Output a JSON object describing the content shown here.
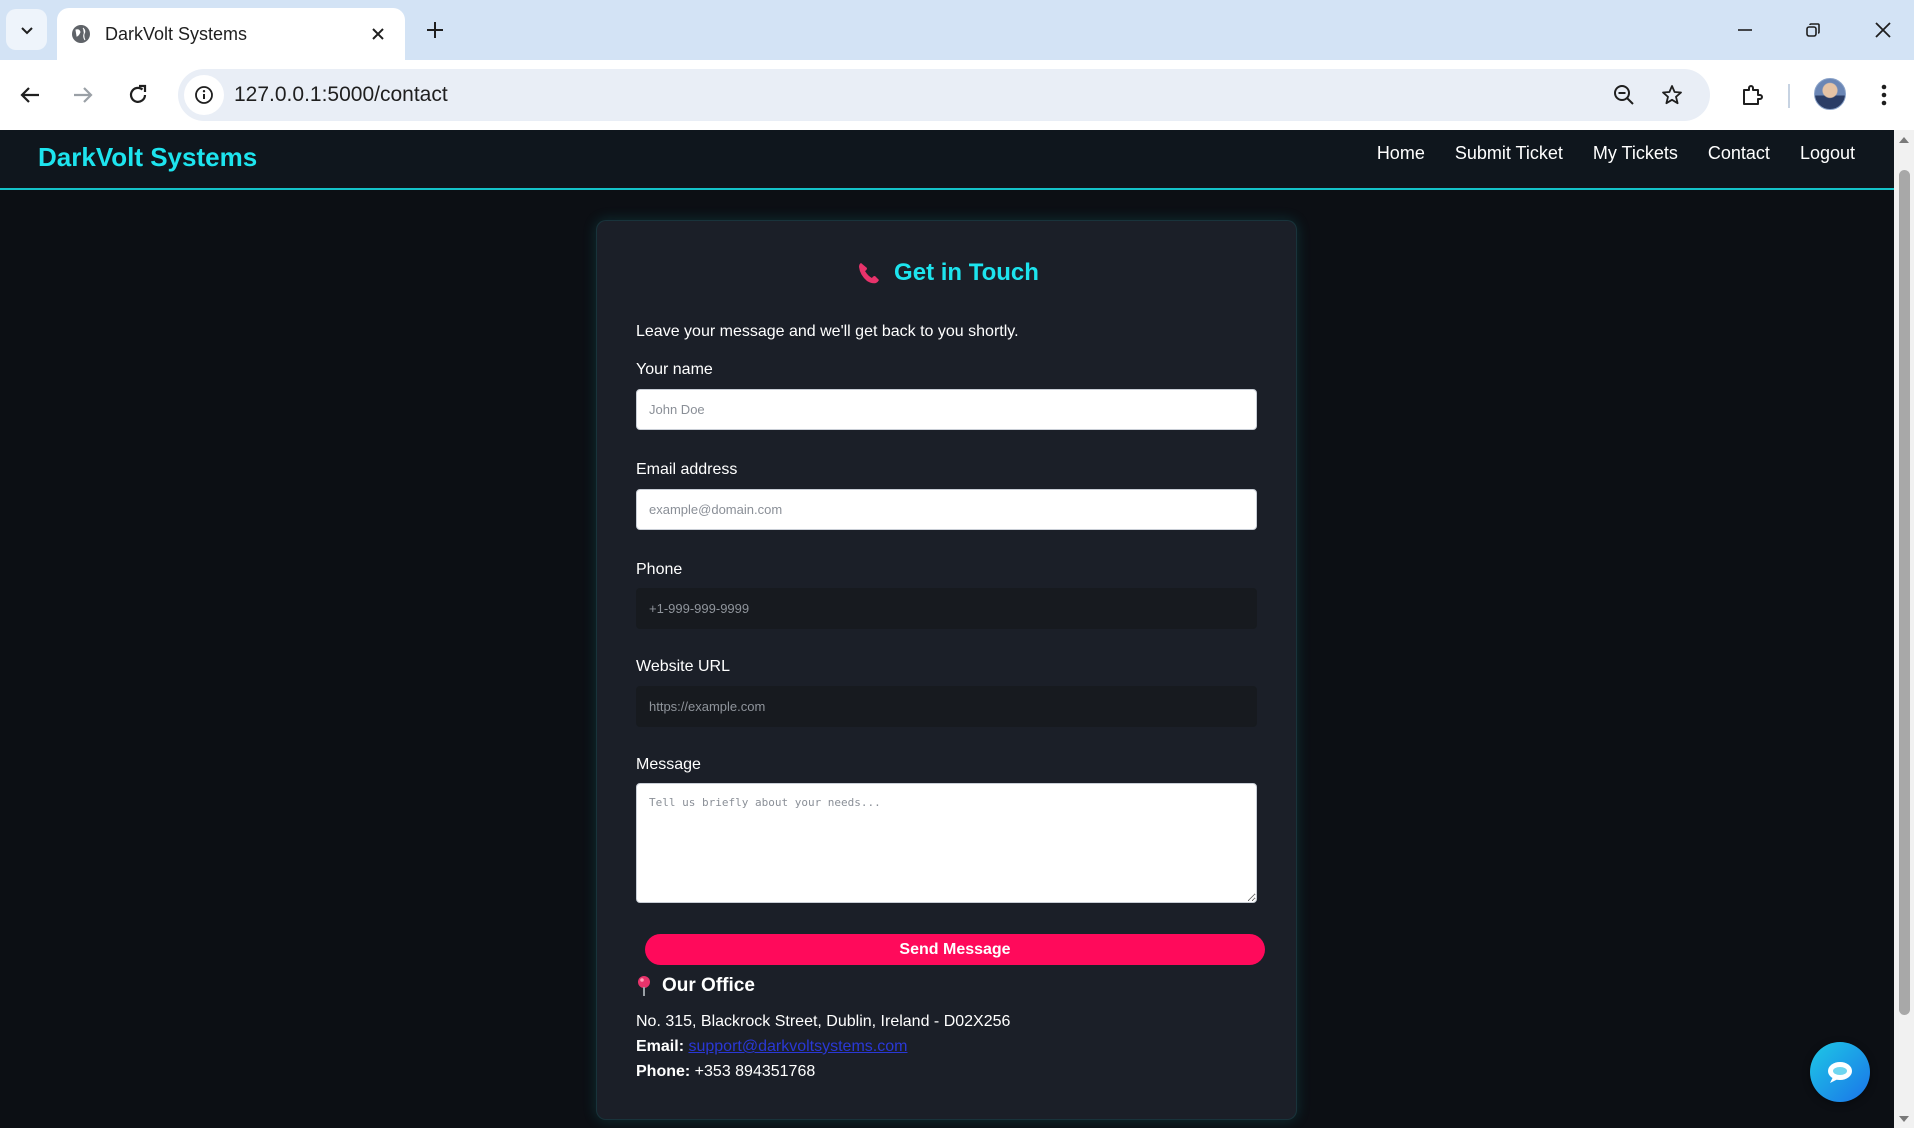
{
  "browser": {
    "tab_title": "DarkVolt Systems",
    "url": "127.0.0.1:5000/contact"
  },
  "site": {
    "brand": "DarkVolt Systems",
    "nav": [
      "Home",
      "Submit Ticket",
      "My Tickets",
      "Contact",
      "Logout"
    ]
  },
  "contact": {
    "title": "Get in Touch",
    "intro": "Leave your message and we'll get back to you shortly.",
    "fields": {
      "name": {
        "label": "Your name",
        "value": "",
        "placeholder": "John Doe"
      },
      "email": {
        "label": "Email address",
        "value": "",
        "placeholder": "example@domain.com"
      },
      "phone": {
        "label": "Phone",
        "value": "",
        "placeholder": "+1-999-999-9999"
      },
      "website": {
        "label": "Website URL",
        "value": "",
        "placeholder": "https://example.com"
      },
      "message": {
        "label": "Message",
        "value": "",
        "placeholder": "Tell us briefly about your needs..."
      }
    },
    "send_label": "Send Message"
  },
  "office": {
    "title": "Our Office",
    "address": "No. 315, Blackrock Street, Dublin, Ireland - D02X256",
    "email_label": "Email:",
    "email": "support@darkvoltsystems.com",
    "phone_label": "Phone:",
    "phone": "+353 894351768"
  },
  "colors": {
    "accent_cyan": "#1de4ee",
    "send_button": "#ff0a5b",
    "page_bg": "#0c0f14",
    "card_bg": "#1b1f28"
  },
  "icons": {
    "title_icon": "telephone-receiver-icon",
    "office_icon": "round-pushpin-icon",
    "chat_icon": "chat-bubble-icon"
  }
}
